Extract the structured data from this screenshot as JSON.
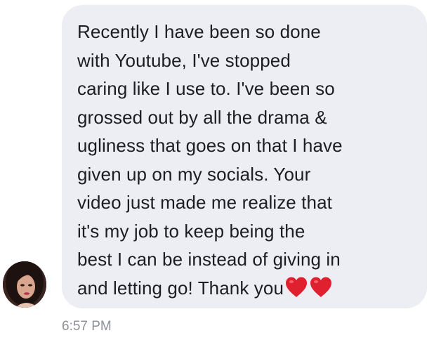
{
  "message": {
    "lines": [
      "Recently I have been so done",
      "with Youtube, I've stopped",
      "caring like I use to. I've been so",
      "grossed out by all the drama &",
      "ugliness that goes on that I have",
      "given up on my socials. Your",
      "video just made me realize that",
      "it's my job to keep being the",
      "best I can be instead of giving in"
    ],
    "last_line": "and letting go! Thank you",
    "emoji": [
      "red-heart",
      "red-heart"
    ],
    "timestamp": "6:57 PM"
  },
  "colors": {
    "bubble": "#edeef3",
    "text": "#1c1e21",
    "timestamp": "#8e9199",
    "heart": "#e0202e"
  }
}
